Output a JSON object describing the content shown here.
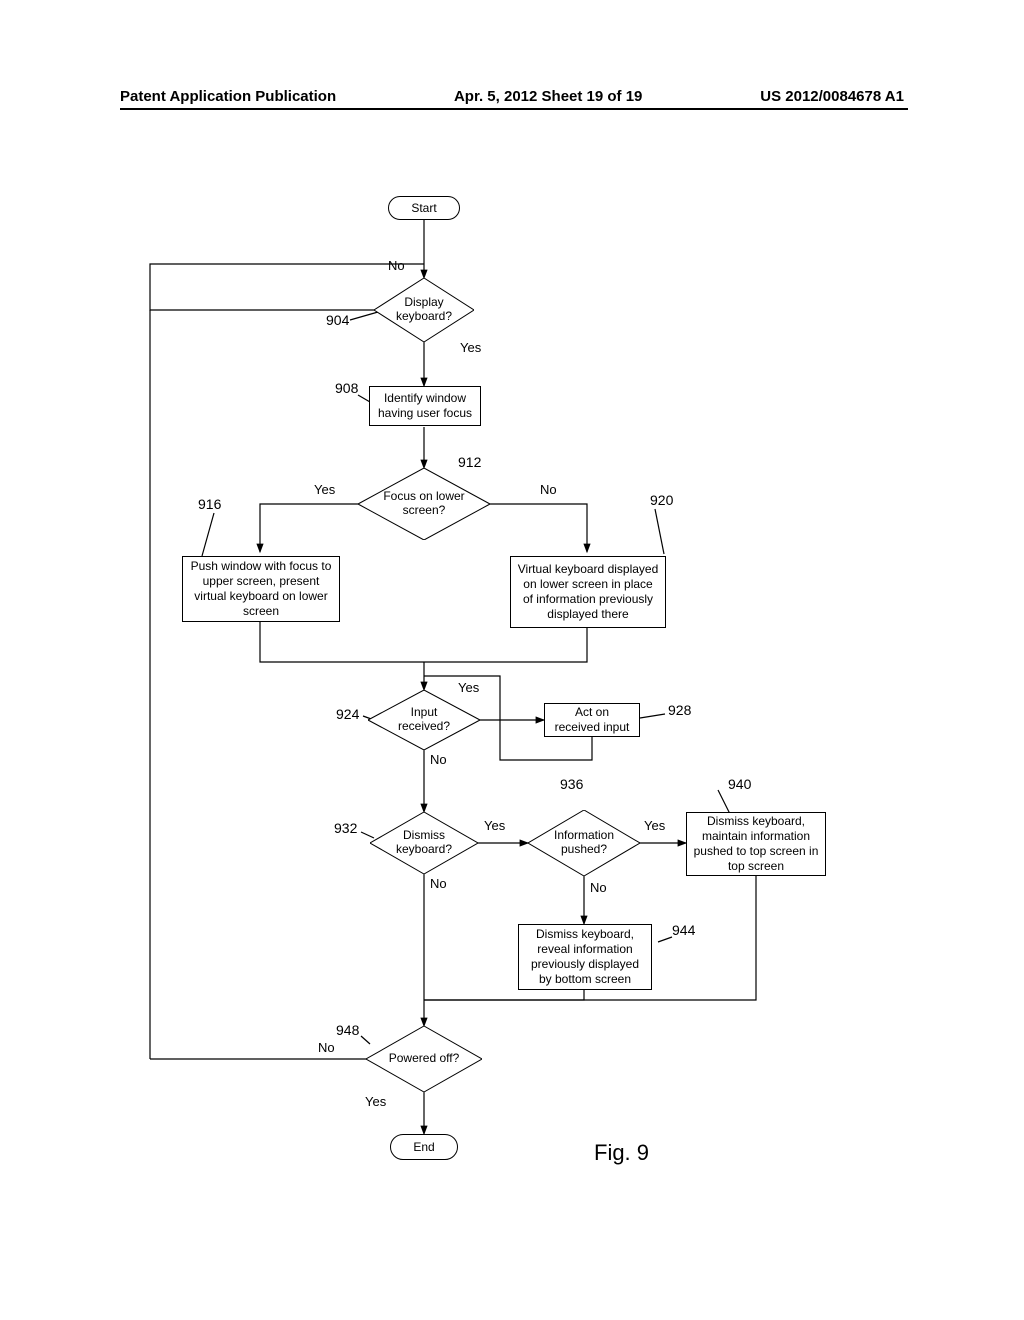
{
  "header": {
    "left": "Patent Application Publication",
    "center": "Apr. 5, 2012  Sheet 19 of 19",
    "right": "US 2012/0084678 A1"
  },
  "nodes": {
    "start": "Start",
    "d904": "Display keyboard?",
    "p908": "Identify window having user focus",
    "d912": "Focus on lower screen?",
    "p916": "Push window with focus to upper screen, present virtual keyboard on lower screen",
    "p920": "Virtual keyboard displayed on lower screen in place of information previously displayed there",
    "d924": "Input received?",
    "p928": "Act on received input",
    "d932": "Dismiss keyboard?",
    "d936": "Information pushed?",
    "p940": "Dismiss keyboard, maintain information pushed to top screen in top screen",
    "p944": "Dismiss keyboard, reveal information previously displayed by bottom screen",
    "d948": "Powered off?",
    "end": "End"
  },
  "labels": {
    "no": "No",
    "yes": "Yes"
  },
  "refs": {
    "r904": "904",
    "r908": "908",
    "r912": "912",
    "r916": "916",
    "r920": "920",
    "r924": "924",
    "r928": "928",
    "r932": "932",
    "r936": "936",
    "r940": "940",
    "r944": "944",
    "r948": "948"
  },
  "figure": "Fig. 9"
}
